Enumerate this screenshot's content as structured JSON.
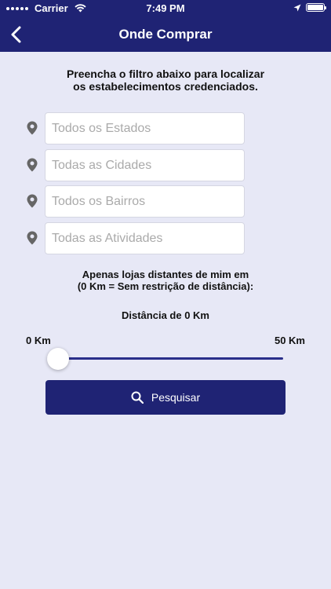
{
  "status_bar": {
    "carrier": "Carrier",
    "time": "7:49 PM"
  },
  "header": {
    "title": "Onde Comprar",
    "back_icon": "chevron-left-icon"
  },
  "intro": {
    "line1": "Preencha o filtro abaixo para localizar",
    "line2": "os estabelecimentos credenciados."
  },
  "filters": [
    {
      "placeholder": "Todos os Estados",
      "icon": "location-pin-icon"
    },
    {
      "placeholder": "Todas as Cidades",
      "icon": "location-pin-icon"
    },
    {
      "placeholder": "Todos os Bairros",
      "icon": "location-pin-icon"
    },
    {
      "placeholder": "Todas as Atividades",
      "icon": "location-pin-icon"
    }
  ],
  "distance": {
    "note_line1": "Apenas lojas distantes de mim em",
    "note_line2": "(0 Km = Sem restrição de distância):",
    "current_label": "Distância de 0 Km",
    "min_label": "0 Km",
    "max_label": "50 Km",
    "value_km": 0,
    "min_km": 0,
    "max_km": 50
  },
  "search_button": {
    "label": "Pesquisar",
    "icon": "search-icon"
  },
  "colors": {
    "primary": "#1f2374",
    "background": "#e7e8f6",
    "slider_track": "#2a2e8a"
  }
}
